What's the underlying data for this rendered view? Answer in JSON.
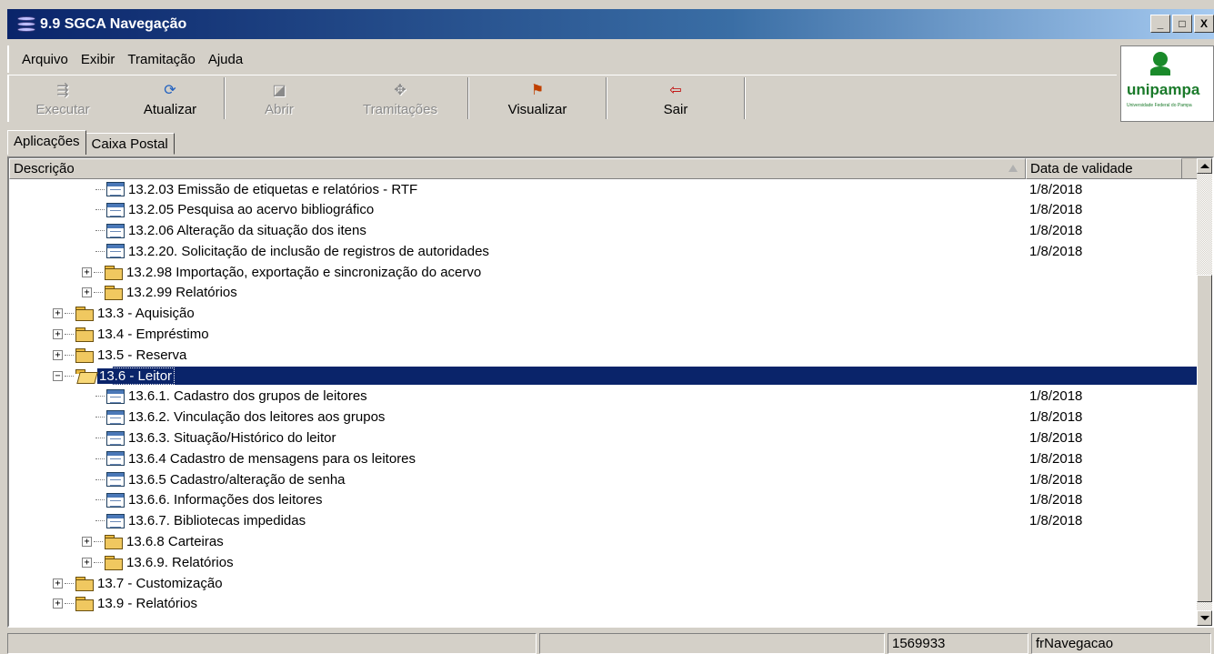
{
  "window": {
    "title": "9.9 SGCA Navegação",
    "buttons": [
      "_",
      "□",
      "X"
    ]
  },
  "menu": [
    "Arquivo",
    "Exibir",
    "Tramitação",
    "Ajuda"
  ],
  "toolbar": {
    "executar": "Executar",
    "atualizar": "Atualizar",
    "abrir": "Abrir",
    "tramitacoes": "Tramitações",
    "visualizar": "Visualizar",
    "sair": "Sair"
  },
  "logo": {
    "brand": "unipampa",
    "subtitle": "Universidade Federal do Pampa"
  },
  "tabs": [
    "Aplicações",
    "Caixa Postal"
  ],
  "columns": {
    "descricao": "Descrição",
    "data_validade": "Data de validade"
  },
  "rows": [
    {
      "level": 2,
      "type": "window",
      "label": "13.2.03 Emissão de etiquetas e relatórios - RTF",
      "date": "1/8/2018"
    },
    {
      "level": 2,
      "type": "window",
      "label": "13.2.05 Pesquisa ao acervo bibliográfico",
      "date": "1/8/2018"
    },
    {
      "level": 2,
      "type": "window",
      "label": "13.2.06 Alteração da situação dos itens",
      "date": "1/8/2018"
    },
    {
      "level": 2,
      "type": "window",
      "label": "13.2.20. Solicitação de inclusão de registros de autoridades",
      "date": "1/8/2018"
    },
    {
      "level": 2,
      "type": "folder",
      "label": "13.2.98 Importação, exportação e sincronização do acervo",
      "date": ""
    },
    {
      "level": 2,
      "type": "folder",
      "label": "13.2.99 Relatórios",
      "date": ""
    },
    {
      "level": 1,
      "type": "folder",
      "label": "13.3 - Aquisição",
      "date": ""
    },
    {
      "level": 1,
      "type": "folder",
      "label": "13.4 - Empréstimo",
      "date": ""
    },
    {
      "level": 1,
      "type": "folder",
      "label": "13.5 - Reserva",
      "date": ""
    },
    {
      "level": 1,
      "type": "folder-open",
      "label": "13.6 - Leitor",
      "date": "",
      "selected": true
    },
    {
      "level": 2,
      "type": "window",
      "label": "13.6.1. Cadastro dos grupos de leitores",
      "date": "1/8/2018"
    },
    {
      "level": 2,
      "type": "window",
      "label": "13.6.2. Vinculação dos leitores aos grupos",
      "date": "1/8/2018"
    },
    {
      "level": 2,
      "type": "window",
      "label": "13.6.3. Situação/Histórico do leitor",
      "date": "1/8/2018"
    },
    {
      "level": 2,
      "type": "window",
      "label": "13.6.4 Cadastro de mensagens para os leitores",
      "date": "1/8/2018"
    },
    {
      "level": 2,
      "type": "window",
      "label": "13.6.5 Cadastro/alteração de senha",
      "date": "1/8/2018"
    },
    {
      "level": 2,
      "type": "window",
      "label": "13.6.6. Informações dos leitores",
      "date": "1/8/2018"
    },
    {
      "level": 2,
      "type": "window",
      "label": "13.6.7. Bibliotecas impedidas",
      "date": "1/8/2018"
    },
    {
      "level": 2,
      "type": "folder",
      "label": "13.6.8 Carteiras",
      "date": ""
    },
    {
      "level": 2,
      "type": "folder",
      "label": "13.6.9. Relatórios",
      "date": ""
    },
    {
      "level": 1,
      "type": "folder",
      "label": "13.7 - Customização",
      "date": ""
    },
    {
      "level": 1,
      "type": "folder",
      "label": "13.9 - Relatórios",
      "date": ""
    }
  ],
  "status": {
    "panel1": "",
    "panel2": "",
    "user_id": "1569933",
    "form_name": "frNavegacao"
  },
  "colors": {
    "title_start": "#0a246a",
    "selection": "#0a246a",
    "face": "#d4d0c8",
    "brand_green": "#1a7a2a"
  }
}
